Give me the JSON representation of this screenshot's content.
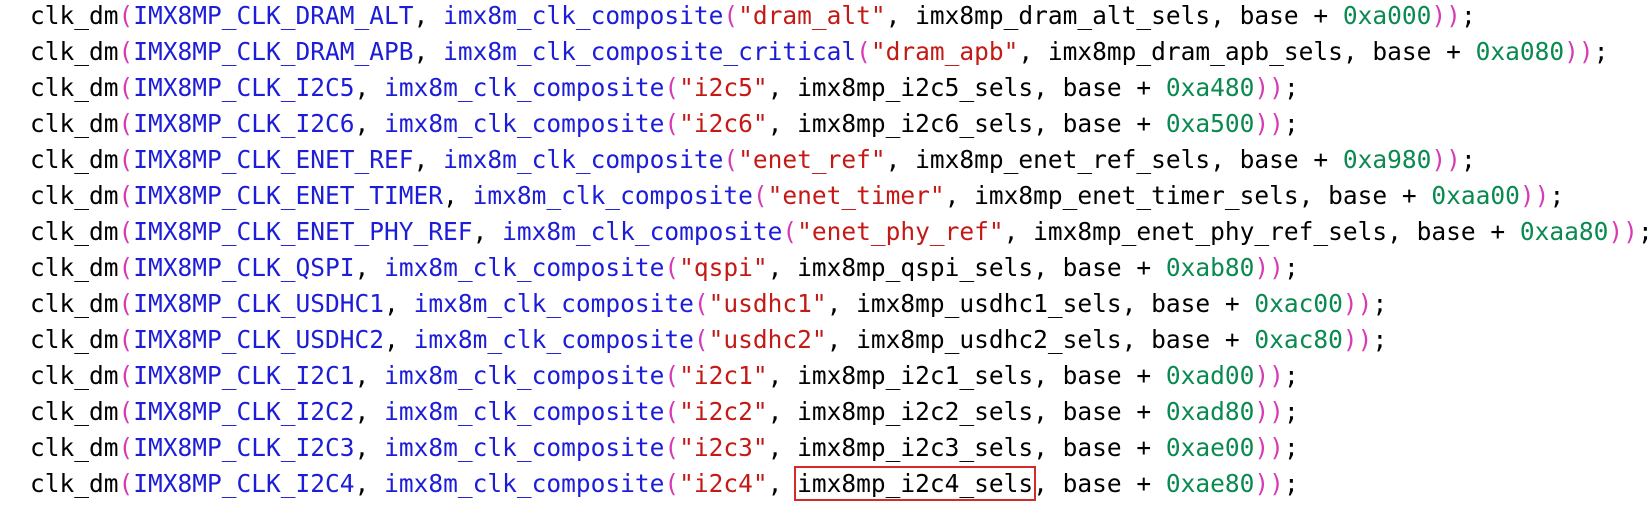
{
  "colors": {
    "paren": "#d63bb5",
    "constant": "#1d1dd8",
    "call": "#1d1dd8",
    "string": "#c41a16",
    "number": "#0a8a4f",
    "plain": "#000000",
    "highlight_border": "#d42a2a"
  },
  "code_lines": [
    {
      "fn": "clk_dm",
      "const": "IMX8MP_CLK_DRAM_ALT",
      "call": "imx8m_clk_composite",
      "str": "\"dram_alt\"",
      "sels": "imx8mp_dram_alt_sels",
      "addr": "0xa000",
      "highlight": false
    },
    {
      "fn": "clk_dm",
      "const": "IMX8MP_CLK_DRAM_APB",
      "call": "imx8m_clk_composite_critical",
      "str": "\"dram_apb\"",
      "sels": "imx8mp_dram_apb_sels",
      "addr": "0xa080",
      "highlight": false
    },
    {
      "fn": "clk_dm",
      "const": "IMX8MP_CLK_I2C5",
      "call": "imx8m_clk_composite",
      "str": "\"i2c5\"",
      "sels": "imx8mp_i2c5_sels",
      "addr": "0xa480",
      "highlight": false
    },
    {
      "fn": "clk_dm",
      "const": "IMX8MP_CLK_I2C6",
      "call": "imx8m_clk_composite",
      "str": "\"i2c6\"",
      "sels": "imx8mp_i2c6_sels",
      "addr": "0xa500",
      "highlight": false
    },
    {
      "fn": "clk_dm",
      "const": "IMX8MP_CLK_ENET_REF",
      "call": "imx8m_clk_composite",
      "str": "\"enet_ref\"",
      "sels": "imx8mp_enet_ref_sels",
      "addr": "0xa980",
      "highlight": false
    },
    {
      "fn": "clk_dm",
      "const": "IMX8MP_CLK_ENET_TIMER",
      "call": "imx8m_clk_composite",
      "str": "\"enet_timer\"",
      "sels": "imx8mp_enet_timer_sels",
      "addr": "0xaa00",
      "highlight": false
    },
    {
      "fn": "clk_dm",
      "const": "IMX8MP_CLK_ENET_PHY_REF",
      "call": "imx8m_clk_composite",
      "str": "\"enet_phy_ref\"",
      "sels": "imx8mp_enet_phy_ref_sels",
      "addr": "0xaa80",
      "highlight": false
    },
    {
      "fn": "clk_dm",
      "const": "IMX8MP_CLK_QSPI",
      "call": "imx8m_clk_composite",
      "str": "\"qspi\"",
      "sels": "imx8mp_qspi_sels",
      "addr": "0xab80",
      "highlight": false
    },
    {
      "fn": "clk_dm",
      "const": "IMX8MP_CLK_USDHC1",
      "call": "imx8m_clk_composite",
      "str": "\"usdhc1\"",
      "sels": "imx8mp_usdhc1_sels",
      "addr": "0xac00",
      "highlight": false
    },
    {
      "fn": "clk_dm",
      "const": "IMX8MP_CLK_USDHC2",
      "call": "imx8m_clk_composite",
      "str": "\"usdhc2\"",
      "sels": "imx8mp_usdhc2_sels",
      "addr": "0xac80",
      "highlight": false
    },
    {
      "fn": "clk_dm",
      "const": "IMX8MP_CLK_I2C1",
      "call": "imx8m_clk_composite",
      "str": "\"i2c1\"",
      "sels": "imx8mp_i2c1_sels",
      "addr": "0xad00",
      "highlight": false
    },
    {
      "fn": "clk_dm",
      "const": "IMX8MP_CLK_I2C2",
      "call": "imx8m_clk_composite",
      "str": "\"i2c2\"",
      "sels": "imx8mp_i2c2_sels",
      "addr": "0xad80",
      "highlight": false
    },
    {
      "fn": "clk_dm",
      "const": "IMX8MP_CLK_I2C3",
      "call": "imx8m_clk_composite",
      "str": "\"i2c3\"",
      "sels": "imx8mp_i2c3_sels",
      "addr": "0xae00",
      "highlight": false
    },
    {
      "fn": "clk_dm",
      "const": "IMX8MP_CLK_I2C4",
      "call": "imx8m_clk_composite",
      "str": "\"i2c4\"",
      "sels": "imx8mp_i2c4_sels",
      "addr": "0xae80",
      "highlight": true
    }
  ],
  "punct": {
    "open_paren": "(",
    "close_parens": "))",
    "comma_space": ", ",
    "base_plus": ", base + ",
    "semicolon": ";"
  }
}
